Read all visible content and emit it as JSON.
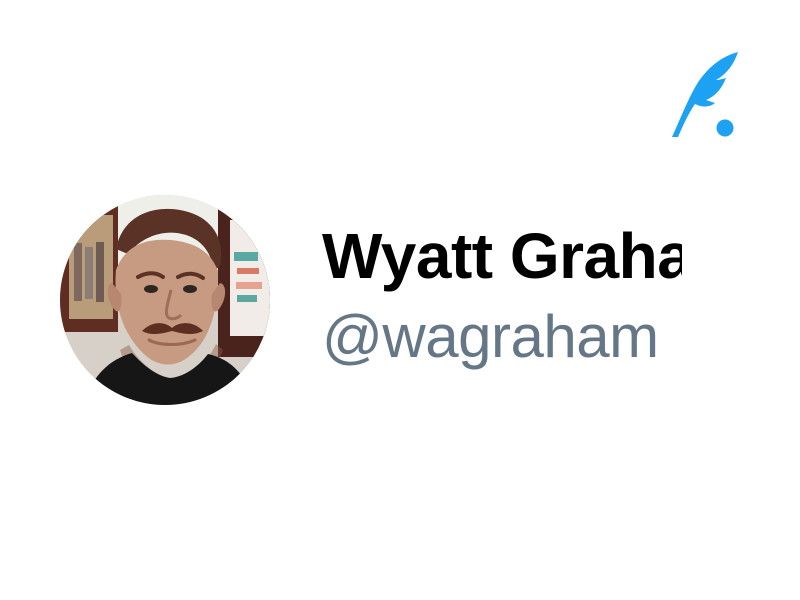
{
  "brand": {
    "icon": "feather-quill-icon",
    "color": "#1da1f2"
  },
  "profile": {
    "display_name": "Wyatt Graham",
    "handle": "@wagraham",
    "avatar_icon": "profile-photo",
    "name_color": "#000000",
    "handle_color": "#657786"
  }
}
